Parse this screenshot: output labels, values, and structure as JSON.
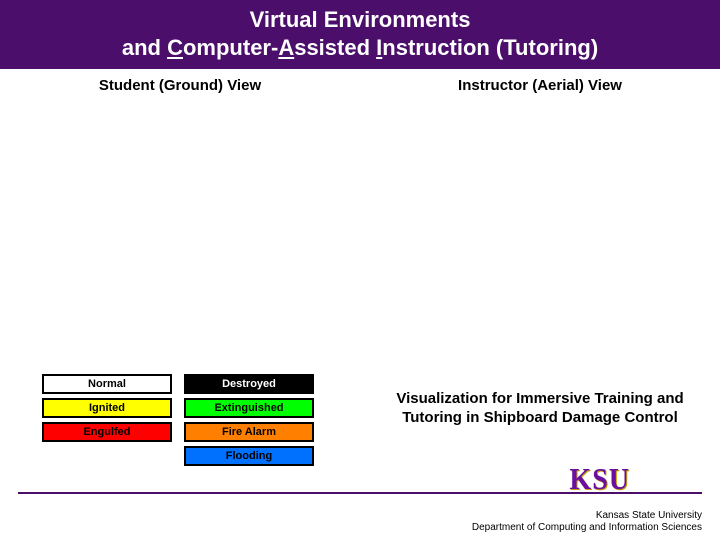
{
  "title": {
    "prefix": "Virtual Environments",
    "line2_a": "and ",
    "c": "C",
    "line2_b": "omputer-",
    "a": "A",
    "line2_c": "ssisted ",
    "i": "I",
    "line2_d": "nstruction (Tutoring)"
  },
  "subtitles": {
    "left": "Student (Ground) View",
    "right": "Instructor (Aerial) View"
  },
  "legend": {
    "rows": [
      {
        "left": "Normal",
        "right": "Destroyed"
      },
      {
        "left": "Ignited",
        "right": "Extinguished"
      },
      {
        "left": "Engulfed",
        "right": "Fire Alarm"
      },
      {
        "left": "",
        "right": "Flooding"
      }
    ]
  },
  "summary": "Visualization for Immersive Training and Tutoring in Shipboard Damage Control",
  "logo": "KSU",
  "footer": {
    "line1": "Kansas State University",
    "line2": "Department of Computing and Information Sciences"
  }
}
